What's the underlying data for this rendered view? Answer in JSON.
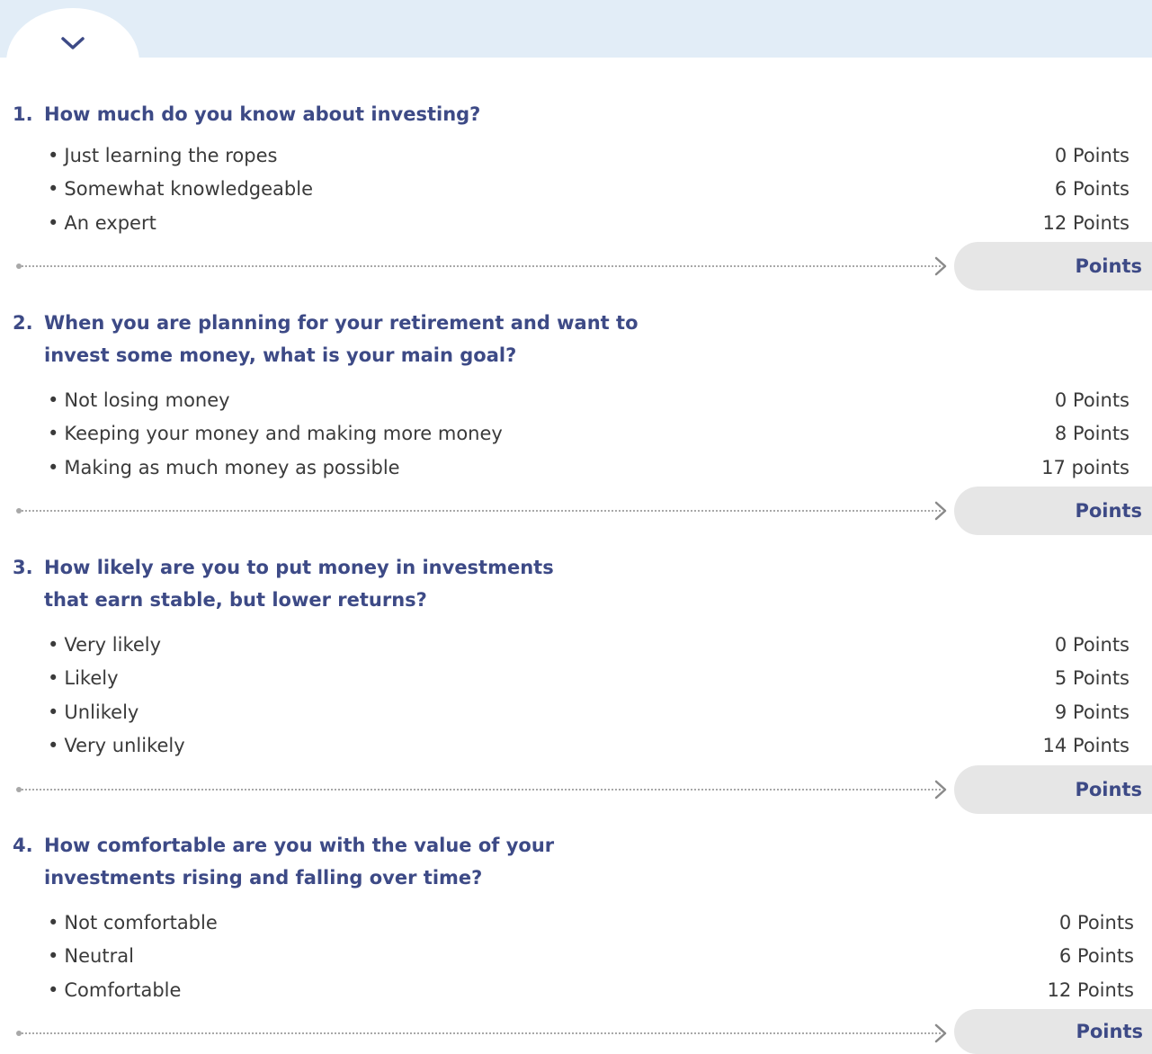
{
  "header": {
    "collapse_icon": "chevron-down-icon"
  },
  "questions": [
    {
      "number": "1.",
      "title": "How much do you know about investing?",
      "options": [
        {
          "label": "Just learning the ropes",
          "points": "0 Points"
        },
        {
          "label": "Somewhat knowledgeable",
          "points": "6 Points"
        },
        {
          "label": "An expert",
          "points": "12 Points"
        }
      ],
      "score_label": "Points"
    },
    {
      "number": "2.",
      "title": "When you are planning for your retirement and want to invest some money, what is your main goal?",
      "options": [
        {
          "label": "Not losing money",
          "points": "0 Points"
        },
        {
          "label": "Keeping your money and making more money",
          "points": "8 Points"
        },
        {
          "label": "Making as much money as possible",
          "points": "17 points"
        }
      ],
      "score_label": "Points"
    },
    {
      "number": "3.",
      "title": "How likely are you to put money in investments that earn stable, but lower returns?",
      "options": [
        {
          "label": "Very likely",
          "points": "0 Points"
        },
        {
          "label": "Likely",
          "points": "5 Points"
        },
        {
          "label": "Unlikely",
          "points": "9 Points"
        },
        {
          "label": "Very unlikely",
          "points": "14 Points"
        }
      ],
      "score_label": "Points"
    },
    {
      "number": "4.",
      "title": "How comfortable are you with the value of your investments rising and falling over time?",
      "options": [
        {
          "label": "Not comfortable",
          "points": "0 Points"
        },
        {
          "label": "Neutral",
          "points": "6 Points"
        },
        {
          "label": "Comfortable",
          "points": "12 Points"
        }
      ],
      "score_label": "Points"
    }
  ],
  "colors": {
    "heading": "#3d4a86",
    "band": "#e2edf7",
    "pill": "#e6e6e6",
    "dots": "#a8a8a8"
  }
}
